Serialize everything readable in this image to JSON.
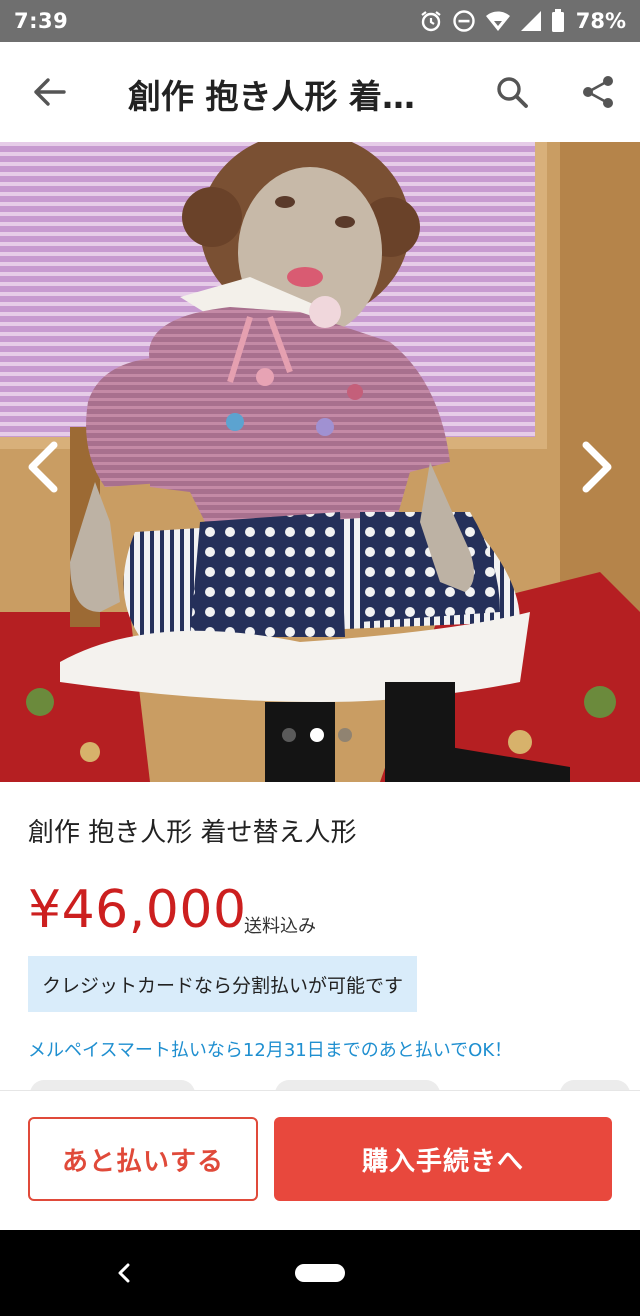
{
  "status_bar": {
    "time": "7:39",
    "battery_percent": "78%",
    "icons": [
      "alarm-icon",
      "do-not-disturb-icon",
      "wifi-icon",
      "signal-icon",
      "battery-icon"
    ]
  },
  "header": {
    "title": "創作 抱き人形 着…",
    "back_icon": "arrow-left-icon",
    "search_icon": "search-icon",
    "share_icon": "share-icon"
  },
  "carousel": {
    "total_images": 3,
    "active_index": 1,
    "prev_icon": "chevron-left-icon",
    "next_icon": "chevron-right-icon"
  },
  "item": {
    "title": "創作 抱き人形 着せ替え人形",
    "price": "¥46,000",
    "shipping_note": "送料込み",
    "credit_banner": "クレジットカードなら分割払いが可能です",
    "merpay_note": "メルペイスマート払いなら12月31日までのあと払いでOK！"
  },
  "actions": {
    "later_pay_label": "あと払いする",
    "purchase_label": "購入手続きへ"
  },
  "colors": {
    "price_red": "#cc1f1f",
    "button_red": "#e8483d",
    "banner_blue": "#d9ecfa",
    "link_blue": "#1f8fd0"
  }
}
